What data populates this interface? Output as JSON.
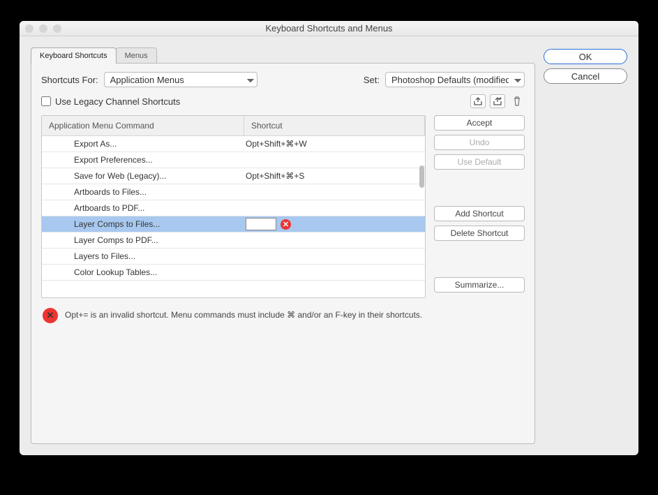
{
  "title": "Keyboard Shortcuts and Menus",
  "tabs": {
    "shortcuts": "Keyboard Shortcuts",
    "menus": "Menus"
  },
  "row1": {
    "shortcuts_for_label": "Shortcuts For:",
    "shortcuts_for_value": "Application Menus",
    "set_label": "Set:",
    "set_value": "Photoshop Defaults (modified)"
  },
  "legacy_label": "Use Legacy Channel Shortcuts",
  "headers": {
    "cmd": "Application Menu Command",
    "sc": "Shortcut"
  },
  "rows": [
    {
      "cmd": "Export As...",
      "sc": "Opt+Shift+⌘+W"
    },
    {
      "cmd": "Export Preferences...",
      "sc": ""
    },
    {
      "cmd": "Save for Web (Legacy)...",
      "sc": "Opt+Shift+⌘+S"
    },
    {
      "cmd": "Artboards to Files...",
      "sc": ""
    },
    {
      "cmd": "Artboards to PDF...",
      "sc": ""
    },
    {
      "cmd": "Layer Comps to Files...",
      "sc": "",
      "selected": true,
      "editing": true,
      "invalid": true
    },
    {
      "cmd": "Layer Comps to PDF...",
      "sc": ""
    },
    {
      "cmd": "Layers to Files...",
      "sc": ""
    },
    {
      "cmd": "Color Lookup Tables...",
      "sc": ""
    }
  ],
  "side": {
    "accept": "Accept",
    "undo": "Undo",
    "use_default": "Use Default",
    "add": "Add Shortcut",
    "delete": "Delete Shortcut",
    "summarize": "Summarize..."
  },
  "error": "Opt+= is an invalid shortcut.  Menu commands must include ⌘ and/or an F-key in their shortcuts.",
  "ok": "OK",
  "cancel": "Cancel",
  "err_x": "✕"
}
